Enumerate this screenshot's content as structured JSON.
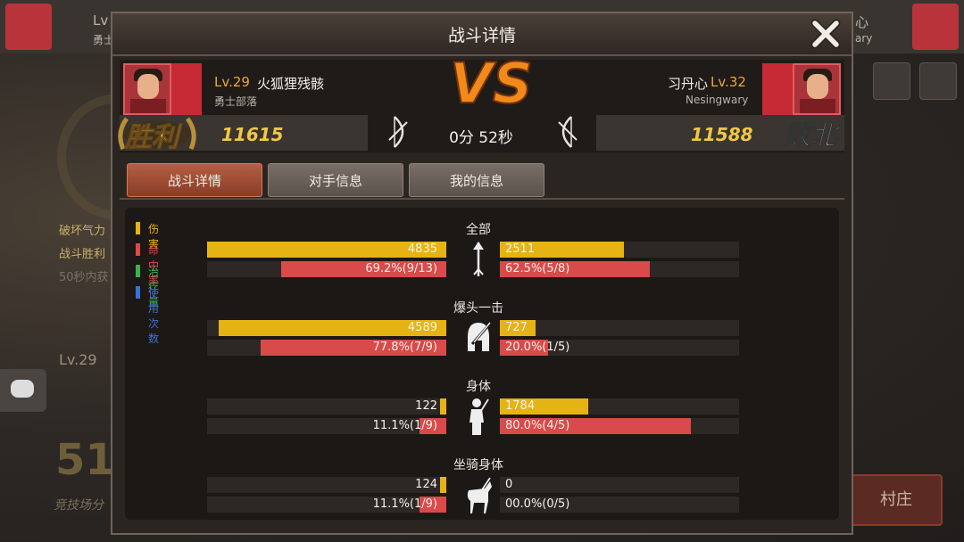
{
  "background": {
    "left_text_1": "破坏气力",
    "left_text_2": "战斗胜利",
    "left_text_3": "50秒内获",
    "left_level": "Lv.29",
    "left_big_number": "51",
    "left_sub": "竞技场分",
    "village_button": "村庄",
    "top_left_lv": "Lv",
    "top_left_sub": "勇士",
    "top_right_name": "心",
    "top_right_sub": "ary"
  },
  "modal": {
    "title": "战斗详情",
    "duration": "0分 52秒"
  },
  "player": {
    "level": "Lv.29",
    "name": "火狐狸残骸",
    "tag": "勇士部落",
    "score": "11615",
    "result": "胜利"
  },
  "opponent": {
    "level": "Lv.32",
    "name": "习丹心",
    "tag": "Nesingwary",
    "score": "11588",
    "result": "败北"
  },
  "tabs": [
    {
      "label": "战斗详情"
    },
    {
      "label": "对手信息"
    },
    {
      "label": "我的信息"
    }
  ],
  "legend": [
    {
      "label": "伤害",
      "color": "#e6b315"
    },
    {
      "label": "命中率",
      "color": "#d94a4a"
    },
    {
      "label": "治疗量",
      "color": "#3fb04f"
    },
    {
      "label": "使用次数",
      "color": "#3a72d9"
    }
  ],
  "colors": {
    "damage": "#e6b315",
    "hit": "#d94a4a",
    "score": "#f2c744",
    "level": "#e9a83a"
  },
  "sections": [
    {
      "title": "全部",
      "icon": "arrow-icon",
      "left_damage": "4835",
      "left_damage_frac": 1.0,
      "right_damage": "2511",
      "right_damage_frac": 0.52,
      "left_hit": "69.2%(9/13)",
      "left_hit_frac": 0.692,
      "right_hit": "62.5%(5/8)",
      "right_hit_frac": 0.625
    },
    {
      "title": "爆头一击",
      "icon": "helmet-icon",
      "left_damage": "4589",
      "left_damage_frac": 0.95,
      "right_damage": "727",
      "right_damage_frac": 0.15,
      "left_hit": "77.8%(7/9)",
      "left_hit_frac": 0.778,
      "right_hit": "20.0%(1/5)",
      "right_hit_frac": 0.2
    },
    {
      "title": "身体",
      "icon": "body-icon",
      "left_damage": "122",
      "left_damage_frac": 0.025,
      "right_damage": "1784",
      "right_damage_frac": 0.37,
      "left_hit": "11.1%(1/9)",
      "left_hit_frac": 0.111,
      "right_hit": "80.0%(4/5)",
      "right_hit_frac": 0.8
    },
    {
      "title": "坐骑身体",
      "icon": "horse-icon",
      "left_damage": "124",
      "left_damage_frac": 0.026,
      "right_damage": "0",
      "right_damage_frac": 0.0,
      "left_hit": "11.1%(1/9)",
      "left_hit_frac": 0.111,
      "right_hit": "00.0%(0/5)",
      "right_hit_frac": 0.0
    }
  ]
}
